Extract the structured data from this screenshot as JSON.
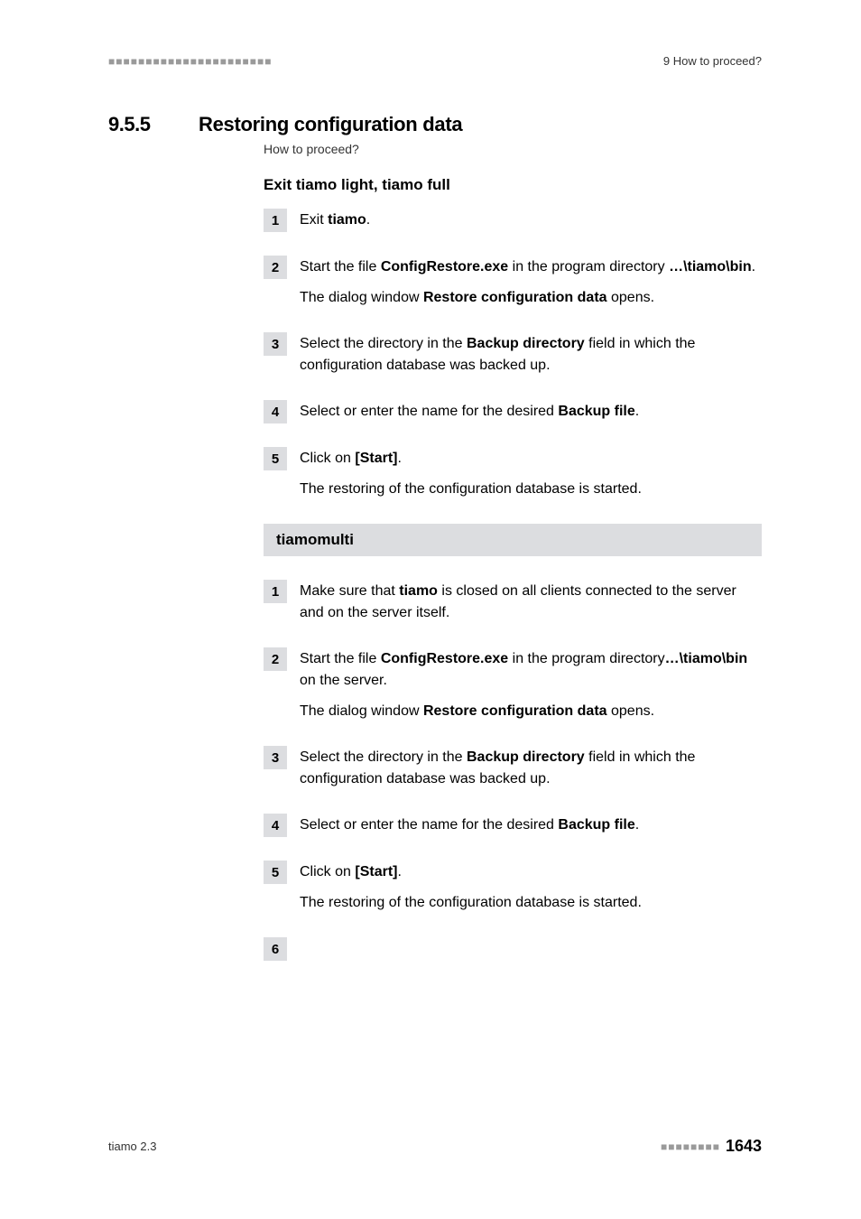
{
  "header": {
    "left_decor": "■■■■■■■■■■■■■■■■■■■■■■",
    "breadcrumb": "9 How to proceed?"
  },
  "section": {
    "number": "9.5.5",
    "title": "Restoring configuration data",
    "subtitle": "How to proceed?"
  },
  "part1": {
    "heading": "Exit tiamo light, tiamo full",
    "steps": [
      {
        "n": "1",
        "paras": [
          {
            "runs": [
              {
                "t": "Exit "
              },
              {
                "t": "tiamo",
                "b": true
              },
              {
                "t": "."
              }
            ]
          }
        ]
      },
      {
        "n": "2",
        "paras": [
          {
            "runs": [
              {
                "t": "Start the file "
              },
              {
                "t": "ConfigRestore.exe",
                "b": true
              },
              {
                "t": " in the program directory "
              },
              {
                "t": "…\\tiamo\\bin",
                "b": true
              },
              {
                "t": "."
              }
            ]
          },
          {
            "runs": [
              {
                "t": "The dialog window "
              },
              {
                "t": "Restore configuration data",
                "b": true
              },
              {
                "t": " opens."
              }
            ]
          }
        ]
      },
      {
        "n": "3",
        "paras": [
          {
            "runs": [
              {
                "t": "Select the directory in the "
              },
              {
                "t": "Backup directory",
                "b": true
              },
              {
                "t": " field in which the configuration database was backed up."
              }
            ]
          }
        ]
      },
      {
        "n": "4",
        "paras": [
          {
            "runs": [
              {
                "t": "Select or enter the name for the desired "
              },
              {
                "t": "Backup file",
                "b": true
              },
              {
                "t": "."
              }
            ]
          }
        ]
      },
      {
        "n": "5",
        "paras": [
          {
            "runs": [
              {
                "t": "Click on "
              },
              {
                "t": "[Start]",
                "b": true
              },
              {
                "t": "."
              }
            ]
          },
          {
            "runs": [
              {
                "t": "The restoring of the configuration database is started."
              }
            ]
          }
        ]
      }
    ]
  },
  "part2": {
    "heading": "tiamomulti",
    "steps": [
      {
        "n": "1",
        "paras": [
          {
            "runs": [
              {
                "t": "Make sure that "
              },
              {
                "t": "tiamo",
                "b": true
              },
              {
                "t": " is closed on all clients connected to the server and on the server itself."
              }
            ]
          }
        ]
      },
      {
        "n": "2",
        "paras": [
          {
            "runs": [
              {
                "t": "Start the file "
              },
              {
                "t": "ConfigRestore.exe",
                "b": true
              },
              {
                "t": " in the program directory"
              },
              {
                "t": "…\\tiamo\\bin",
                "b": true
              },
              {
                "t": " on the server."
              }
            ]
          },
          {
            "runs": [
              {
                "t": "The dialog window "
              },
              {
                "t": "Restore configuration data",
                "b": true
              },
              {
                "t": " opens."
              }
            ]
          }
        ]
      },
      {
        "n": "3",
        "paras": [
          {
            "runs": [
              {
                "t": "Select the directory in the "
              },
              {
                "t": "Backup directory",
                "b": true
              },
              {
                "t": " field in which the configuration database was backed up."
              }
            ]
          }
        ]
      },
      {
        "n": "4",
        "paras": [
          {
            "runs": [
              {
                "t": "Select or enter the name for the desired "
              },
              {
                "t": "Backup file",
                "b": true
              },
              {
                "t": "."
              }
            ]
          }
        ]
      },
      {
        "n": "5",
        "paras": [
          {
            "runs": [
              {
                "t": "Click on "
              },
              {
                "t": "[Start]",
                "b": true
              },
              {
                "t": "."
              }
            ]
          },
          {
            "runs": [
              {
                "t": "The restoring of the configuration database is started."
              }
            ]
          }
        ]
      },
      {
        "n": "6",
        "paras": []
      }
    ]
  },
  "footer": {
    "left": "tiamo 2.3",
    "right_decor": "■■■■■■■■",
    "page_number": "1643"
  }
}
